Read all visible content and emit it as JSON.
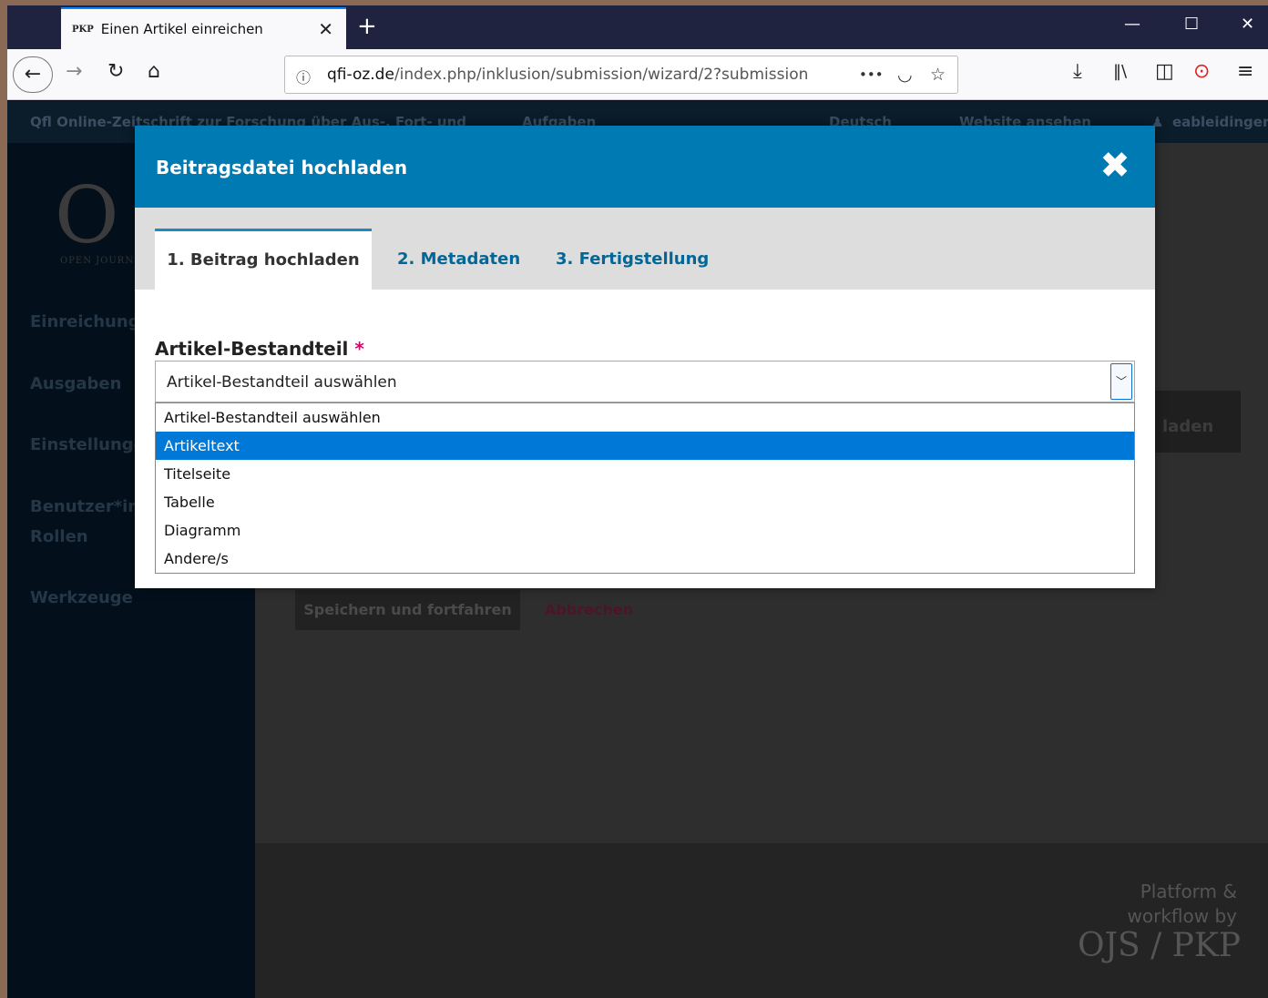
{
  "browser": {
    "tab_favicon": "PKP",
    "tab_title": "Einen Artikel einreichen",
    "url_host": "qfi-oz.de",
    "url_path": "/index.php/inklusion/submission/wizard/2?submission",
    "icons": [
      "back-icon",
      "forward-icon",
      "reload-icon",
      "home-icon",
      "info-icon",
      "more-icon",
      "pocket-icon",
      "star-icon",
      "download-icon",
      "library-icon",
      "sidebar-icon",
      "extension-icon",
      "menu-icon"
    ]
  },
  "site": {
    "journal_name": "Qfl Online-Zeitschrift zur Forschung über Aus-, Fort- und",
    "tasks_label": "Aufgaben",
    "language_label": "Deutsch",
    "view_site_label": "Website ansehen",
    "user_label": "eableidinger",
    "logo_letter": "O",
    "logo_subtitle": "OPEN JOURN"
  },
  "sidebar": {
    "items": [
      "Einreichungen",
      "Ausgaben",
      "Einstellungen",
      "Benutzer*innen &",
      "Rollen",
      "Werkzeuge"
    ]
  },
  "background": {
    "save_label": "Speichern und fortfahren",
    "cancel_label": "Abbrechen",
    "upload_partial": "laden",
    "footer_text_1": "Platform &",
    "footer_text_2": "workflow by",
    "footer_logo": "OJS / PKP"
  },
  "modal": {
    "title": "Beitragsdatei hochladen",
    "close_glyph": "✖",
    "tabs": [
      {
        "label": "1. Beitrag hochladen",
        "active": true
      },
      {
        "label": "2. Metadaten",
        "active": false
      },
      {
        "label": "3. Fertigstellung",
        "active": false
      }
    ],
    "field_label": "Artikel-Bestandteil",
    "required_marker": "*",
    "select_value": "Artikel-Bestandteil auswählen",
    "options": [
      "Artikel-Bestandteil auswählen",
      "Artikeltext",
      "Titelseite",
      "Tabelle",
      "Diagramm",
      "Andere/s"
    ],
    "highlighted_option": 1
  },
  "colors": {
    "modal_header": "#007ab2",
    "tab_link": "#006798",
    "option_highlight": "#0078d7",
    "required": "#d00a6c"
  }
}
